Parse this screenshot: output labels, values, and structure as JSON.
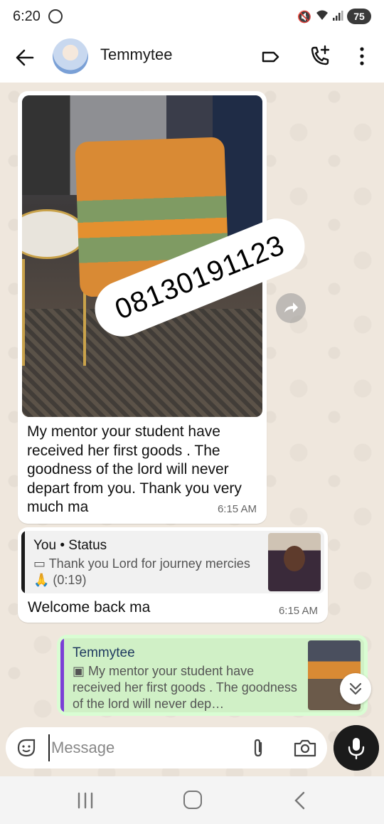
{
  "status_bar": {
    "time": "6:20",
    "battery": "75"
  },
  "header": {
    "contact_name": "Temmytee"
  },
  "messages": [
    {
      "direction": "incoming",
      "type": "image",
      "sticker_text": "08130191123",
      "text": "My mentor your student have received her first goods . The goodness of the lord will never depart from you. Thank you very much ma",
      "time": "6:15 AM"
    },
    {
      "direction": "incoming",
      "type": "reply",
      "quote_title": "You • Status",
      "quote_body": "Thank you Lord for journey mercies 🙏 (0:19)",
      "text": "Welcome back ma",
      "time": "6:15 AM"
    }
  ],
  "reply_draft": {
    "quote_title": "Temmytee",
    "quote_body": "My mentor your student have received her first goods . The goodness of the lord will never dep…"
  },
  "composer": {
    "placeholder": "Message"
  },
  "colors": {
    "chat_background": "#efe7dd",
    "outgoing_bubble": "#d9fdd3",
    "reply_bar": "#7b3fd6"
  }
}
